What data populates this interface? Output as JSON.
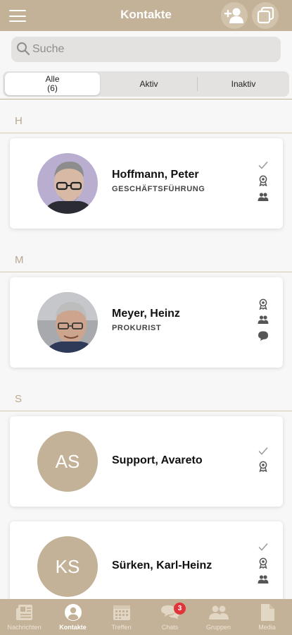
{
  "header": {
    "title": "Kontakte"
  },
  "search": {
    "placeholder": "Suche"
  },
  "filter": {
    "options": [
      {
        "label": "Alle",
        "count": "(6)"
      },
      {
        "label": "Aktiv"
      },
      {
        "label": "Inaktiv"
      }
    ],
    "selected": "Alle"
  },
  "sections": [
    {
      "letter": "H",
      "contacts": [
        {
          "name": "Hoffmann, Peter",
          "role": "GESCHÄFTSFÜHRUNG",
          "icons": [
            "check-icon",
            "award-icon",
            "group-icon"
          ]
        }
      ]
    },
    {
      "letter": "M",
      "contacts": [
        {
          "name": "Meyer, Heinz",
          "role": "PROKURIST",
          "icons": [
            "award-icon",
            "group-icon",
            "chat-icon"
          ]
        }
      ]
    },
    {
      "letter": "S",
      "contacts": [
        {
          "name": "Support, Avareto",
          "initials": "AS",
          "icons": [
            "check-icon",
            "award-icon"
          ]
        },
        {
          "name": "Sürken, Karl-Heinz",
          "initials": "KS",
          "icons": [
            "check-icon",
            "award-icon",
            "group-icon"
          ]
        }
      ]
    }
  ],
  "tabbar": {
    "items": [
      {
        "label": "Nachrichten",
        "icon": "newspaper-icon"
      },
      {
        "label": "Kontakte",
        "icon": "contact-icon"
      },
      {
        "label": "Treffen",
        "icon": "calendar-icon"
      },
      {
        "label": "Chats",
        "icon": "chats-icon",
        "badge": "3"
      },
      {
        "label": "Gruppen",
        "icon": "groups-icon"
      },
      {
        "label": "Media",
        "icon": "document-icon"
      }
    ],
    "active": "Kontakte"
  },
  "colors": {
    "accent": "#c4b298",
    "badge": "#e0333a"
  }
}
